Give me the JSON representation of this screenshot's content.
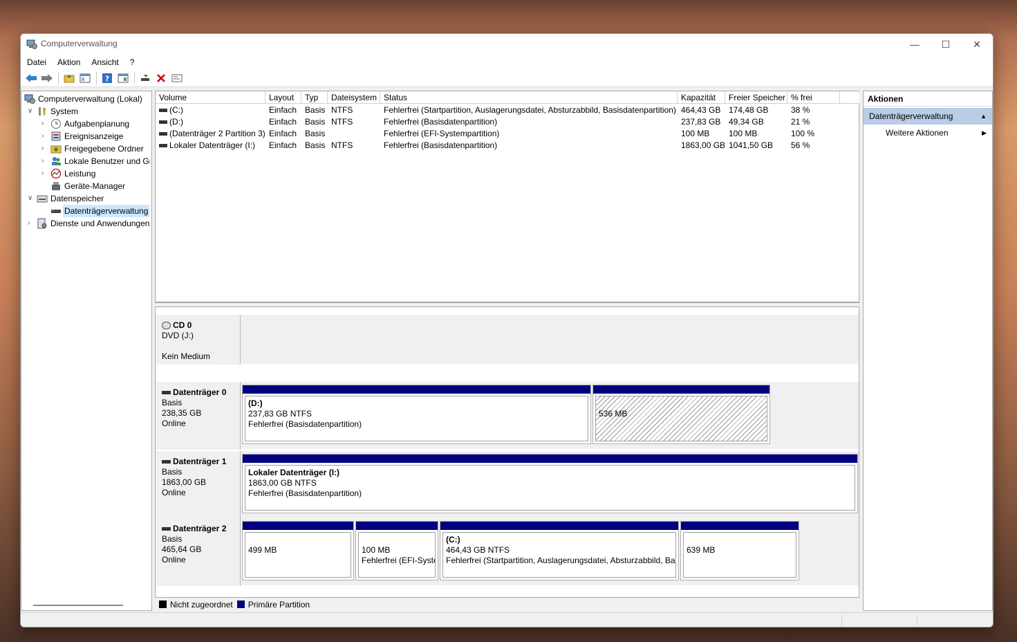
{
  "window": {
    "title": "Computerverwaltung",
    "minimize": "—",
    "maximize": "☐",
    "close": "✕"
  },
  "menu": [
    "Datei",
    "Aktion",
    "Ansicht",
    "?"
  ],
  "toolbar_icons": [
    "back-arrow-icon",
    "forward-arrow-icon",
    "folder-up-icon",
    "show-hide-tree-icon",
    "help-icon",
    "action-pane-icon",
    "connect-icon",
    "delete-icon",
    "properties-icon"
  ],
  "colors": {
    "primary_partition": "#000080",
    "unallocated": "#000000",
    "selected": "#cce8ff",
    "delete": "#d00000"
  },
  "tree": [
    {
      "label": "Computerverwaltung (Lokal)",
      "level": 0,
      "twisty": "",
      "icon": "computer-management-icon"
    },
    {
      "label": "System",
      "level": 1,
      "twisty": "∨",
      "icon": "tools-icon"
    },
    {
      "label": "Aufgabenplanung",
      "level": 2,
      "twisty": "›",
      "icon": "clock-icon"
    },
    {
      "label": "Ereignisanzeige",
      "level": 2,
      "twisty": "›",
      "icon": "event-viewer-icon"
    },
    {
      "label": "Freigegebene Ordner",
      "level": 2,
      "twisty": "›",
      "icon": "shared-folder-icon"
    },
    {
      "label": "Lokale Benutzer und Gru",
      "level": 2,
      "twisty": "›",
      "icon": "users-icon"
    },
    {
      "label": "Leistung",
      "level": 2,
      "twisty": "›",
      "icon": "performance-icon"
    },
    {
      "label": "Geräte-Manager",
      "level": 2,
      "twisty": "",
      "icon": "device-manager-icon"
    },
    {
      "label": "Datenspeicher",
      "level": 1,
      "twisty": "∨",
      "icon": "storage-icon"
    },
    {
      "label": "Datenträgerverwaltung",
      "level": 2,
      "twisty": "",
      "icon": "disk-management-icon",
      "selected": true
    },
    {
      "label": "Dienste und Anwendungen",
      "level": 1,
      "twisty": "›",
      "icon": "services-icon"
    }
  ],
  "list": {
    "columns": [
      "Volume",
      "Layout",
      "Typ",
      "Dateisystem",
      "Status",
      "Kapazität",
      "Freier Speicher",
      "% frei"
    ],
    "rows": [
      [
        "(C:)",
        "Einfach",
        "Basis",
        "NTFS",
        "Fehlerfrei (Startpartition, Auslagerungsdatei, Absturzabbild, Basisdatenpartition)",
        "464,43 GB",
        "174,48 GB",
        "38 %"
      ],
      [
        "(D:)",
        "Einfach",
        "Basis",
        "NTFS",
        "Fehlerfrei (Basisdatenpartition)",
        "237,83 GB",
        "49,34 GB",
        "21 %"
      ],
      [
        "(Datenträger 2 Partition 3)",
        "Einfach",
        "Basis",
        "",
        "Fehlerfrei (EFI-Systempartition)",
        "100 MB",
        "100 MB",
        "100 %"
      ],
      [
        "Lokaler Datenträger (I:)",
        "Einfach",
        "Basis",
        "NTFS",
        "Fehlerfrei (Basisdatenpartition)",
        "1863,00 GB",
        "1041,50 GB",
        "56 %"
      ]
    ]
  },
  "disks": [
    {
      "name": "CD 0",
      "type": "DVD (J:)",
      "size": "",
      "status": "Kein Medium",
      "icon": "cd-drive-icon",
      "volumes": []
    },
    {
      "name": "Datenträger 0",
      "type": "Basis",
      "size": "238,35 GB",
      "status": "Online",
      "icon": "disk-icon",
      "volumes": [
        {
          "title": "(D:)",
          "line1": "237,83 GB NTFS",
          "line2": "Fehlerfrei (Basisdatenpartition)",
          "hatched": false
        },
        {
          "title": "",
          "line1": "536 MB",
          "line2": "",
          "hatched": true
        }
      ]
    },
    {
      "name": "Datenträger 1",
      "type": "Basis",
      "size": "1863,00 GB",
      "status": "Online",
      "icon": "disk-icon",
      "volumes": [
        {
          "title": "Lokaler Datenträger  (I:)",
          "line1": "1863,00 GB NTFS",
          "line2": "Fehlerfrei (Basisdatenpartition)",
          "hatched": false
        }
      ]
    },
    {
      "name": "Datenträger 2",
      "type": "Basis",
      "size": "465,64 GB",
      "status": "Online",
      "icon": "disk-icon",
      "volumes": [
        {
          "title": "",
          "line1": "499 MB",
          "line2": "",
          "hatched": false
        },
        {
          "title": "",
          "line1": "100 MB",
          "line2": "Fehlerfrei (EFI-Systempartition)",
          "hatched": false
        },
        {
          "title": "(C:)",
          "line1": "464,43 GB NTFS",
          "line2": "Fehlerfrei (Startpartition, Auslagerungsdatei, Absturzabbild, Basisdatenpartition)",
          "hatched": false
        },
        {
          "title": "",
          "line1": "639 MB",
          "line2": "",
          "hatched": false
        }
      ]
    }
  ],
  "legend": {
    "unallocated": "Nicht zugeordnet",
    "primary": "Primäre Partition"
  },
  "actions": {
    "header": "Aktionen",
    "section": "Datenträgerverwaltung",
    "more": "Weitere Aktionen",
    "collapse_glyph": "▲",
    "more_glyph": "▶"
  }
}
